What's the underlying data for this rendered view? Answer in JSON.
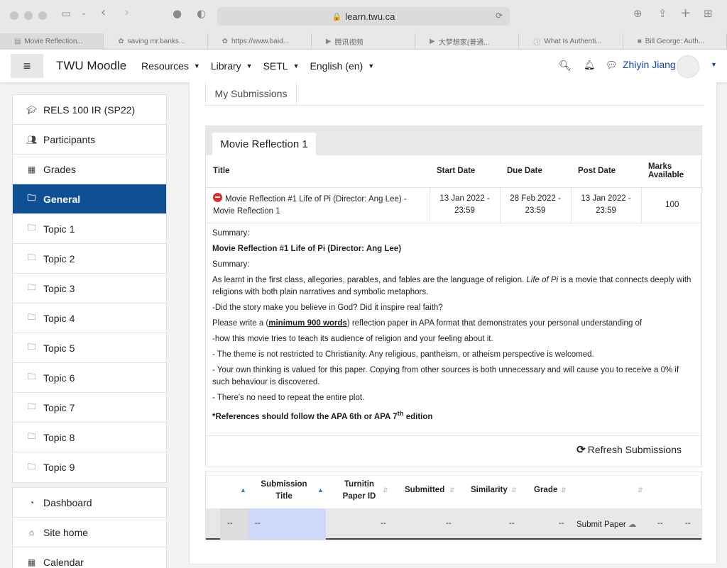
{
  "browser": {
    "url": "learn.twu.ca",
    "tabs": [
      {
        "title": "Movie Reflection..."
      },
      {
        "title": "saving mr.banks..."
      },
      {
        "title": "https://www.baid..."
      },
      {
        "title": "腾讯视频"
      },
      {
        "title": "大梦想家(普通..."
      },
      {
        "title": "What Is Authenti..."
      },
      {
        "title": "Bill George: Auth..."
      }
    ]
  },
  "navbar": {
    "brand": "TWU Moodle",
    "menu": [
      "Resources",
      "Library",
      "SETL",
      "English (en)"
    ],
    "user_name": "Zhiyin Jiang"
  },
  "sidebar": {
    "course": "RELS 100 IR (SP22)",
    "items": [
      "Participants",
      "Grades",
      "General",
      "Topic 1",
      "Topic 2",
      "Topic 3",
      "Topic 4",
      "Topic 5",
      "Topic 6",
      "Topic 7",
      "Topic 8",
      "Topic 9"
    ],
    "global": [
      "Dashboard",
      "Site home",
      "Calendar"
    ]
  },
  "main": {
    "my_submissions_tab": "My Submissions",
    "assignment_tab": "Movie Reflection 1",
    "table": {
      "headers": [
        "Title",
        "Start Date",
        "Due Date",
        "Post Date",
        "Marks Available"
      ],
      "row": {
        "title": "Movie Reflection #1 Life of Pi (Director: Ang Lee) - Movie Reflection 1",
        "start": "13 Jan 2022 - 23:59",
        "due": "28 Feb 2022 - 23:59",
        "post": "13 Jan 2022 - 23:59",
        "marks": "100"
      }
    },
    "summary": {
      "label1": "Summary:",
      "heading": "Movie Reflection #1  Life of Pi (Director: Ang Lee)",
      "label2": "Summary:",
      "p1_before": "As learnt in the first class, allegories, parables, and fables are the language of religion.",
      "p1_em": "Life of Pi",
      "p1_after": "is a movie that connects deeply with religions with both plain narratives and symbolic metaphors.",
      "p2": "-Did the story make you believe in God? Did it inspire real faith?",
      "p3_before": "Please write a (",
      "p3_bold": "minimum 900 words",
      "p3_after": ") reflection paper in APA format that demonstrates your personal understanding of",
      "p4": "-how this movie tries to teach its audience of religion and your feeling about it.",
      "p5": "- The theme is not restricted to Christianity. Any religious, pantheism, or atheism perspective is welcomed.",
      "p6": "- Your own thinking is valued for this paper. Copying from other sources is both unnecessary and will cause you to receive a 0% if such behaviour is discovered.",
      "p7": "- There's no need to repeat the entire plot.",
      "p8_before": "*References should follow the APA 6th or APA 7",
      "p8_sup": "th",
      "p8_after": " edition"
    },
    "refresh_label": "Refresh Submissions",
    "subs_headers": {
      "title": "Submission Title",
      "paper_id": "Turnitin Paper ID",
      "submitted": "Submitted",
      "similarity": "Similarity",
      "grade": "Grade"
    },
    "subs_row": {
      "c1": "--",
      "c2": "--",
      "c3": "--",
      "c4": "--",
      "c5": "--",
      "c6": "--",
      "submit": "Submit Paper",
      "c7": "--",
      "c8": "--"
    }
  }
}
